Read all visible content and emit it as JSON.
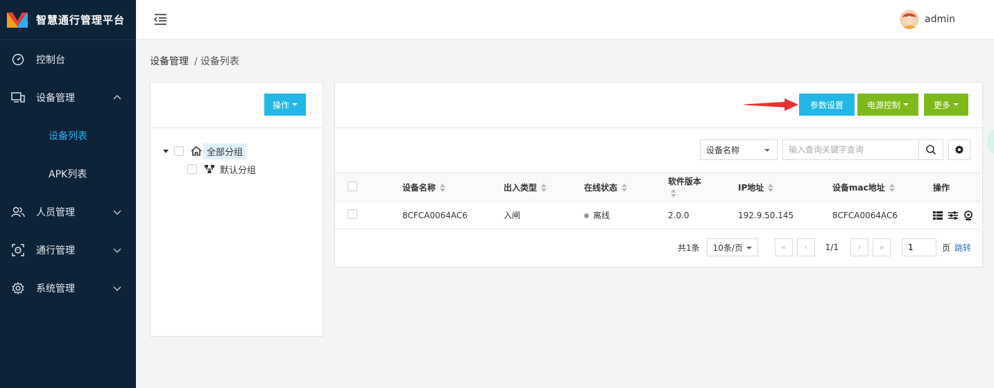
{
  "app": {
    "title": "智慧通行管理平台"
  },
  "sidebar": {
    "items": [
      {
        "label": "控制台",
        "icon": "dashboard-icon"
      },
      {
        "label": "设备管理",
        "icon": "devices-icon",
        "expanded": true,
        "children": [
          {
            "label": "设备列表",
            "active": true
          },
          {
            "label": "APK列表"
          }
        ]
      },
      {
        "label": "人员管理",
        "icon": "people-icon"
      },
      {
        "label": "通行管理",
        "icon": "face-access-icon"
      },
      {
        "label": "系统管理",
        "icon": "gear-icon"
      }
    ]
  },
  "header": {
    "user_name": "admin"
  },
  "breadcrumb": {
    "root": "设备管理",
    "sep": "/",
    "current": "设备列表"
  },
  "left_panel": {
    "action_label": "操作",
    "tree": {
      "root": "全部分组",
      "child": "默认分组"
    }
  },
  "toolbar": {
    "params_label": "参数设置",
    "power_label": "电源控制",
    "more_label": "更多"
  },
  "search": {
    "field_selected": "设备名称",
    "placeholder": "输入查询关键字查询"
  },
  "table": {
    "columns": [
      "设备名称",
      "出入类型",
      "在线状态",
      "软件版本",
      "IP地址",
      "设备mac地址",
      "操作"
    ],
    "rows": [
      {
        "name": "8CFCA0064AC6",
        "type": "入闸",
        "status": "离线",
        "version": "2.0.0",
        "ip": "192.9.50.145",
        "mac": "8CFCA0064AC6"
      }
    ]
  },
  "pagination": {
    "total": "共1条",
    "page_size": "10条/页",
    "first": "«",
    "prev": "‹",
    "page_info": "1/1",
    "next": "›",
    "last": "»",
    "page_input": "1",
    "page_unit": "页",
    "jump": "跳转"
  },
  "colors": {
    "sidebar_bg": "#0d2338",
    "active": "#2ab0f0",
    "blue_button": "#23b7e5",
    "green_button": "#7db91a",
    "arrow": "#e8312f"
  }
}
